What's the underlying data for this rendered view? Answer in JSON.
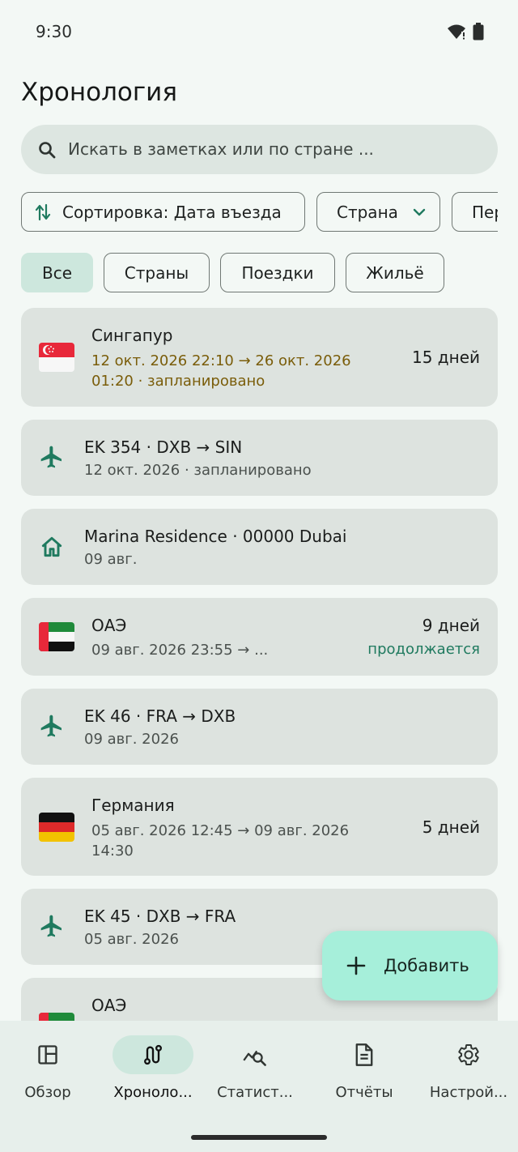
{
  "status_bar": {
    "time": "9:30"
  },
  "page_title": "Хронология",
  "search": {
    "placeholder": "Искать в заметках или по стране ..."
  },
  "chips": {
    "sort_label": "Сортировка: Дата въезда",
    "country_label": "Страна",
    "period_label": "Пер"
  },
  "filters": [
    {
      "label": "Все",
      "active": true
    },
    {
      "label": "Страны",
      "active": false
    },
    {
      "label": "Поездки",
      "active": false
    },
    {
      "label": "Жильё",
      "active": false
    }
  ],
  "timeline": [
    {
      "type": "country",
      "flag": "singapore-flag",
      "title": "Сингапур",
      "line1": "12 окт. 2026 22:10 → 26 окт. 2026",
      "line2": "01:20 · запланировано",
      "days": "15 дней",
      "planned": true
    },
    {
      "type": "flight",
      "icon": "airplane-icon",
      "title": "EK 354 · DXB → SIN",
      "sub": "12 окт. 2026 · запланировано"
    },
    {
      "type": "stay",
      "icon": "home-icon",
      "title": "Marina Residence · 00000 Dubai",
      "sub": "09 авг."
    },
    {
      "type": "country",
      "flag": "uae-flag",
      "title": "ОАЭ",
      "line1": "09 авг. 2026 23:55 → ...",
      "days": "9 дней",
      "status": "продолжается"
    },
    {
      "type": "flight",
      "icon": "airplane-icon",
      "title": "EK 46 · FRA → DXB",
      "sub": "09 авг. 2026"
    },
    {
      "type": "country",
      "flag": "germany-flag",
      "title": "Германия",
      "line1": "05 авг. 2026 12:45 → 09 авг. 2026",
      "line2": "14:30",
      "days": "5 дней"
    },
    {
      "type": "flight",
      "icon": "airplane-icon",
      "title": "EK 45 · DXB → FRA",
      "sub": "05 авг. 2026"
    },
    {
      "type": "country",
      "flag": "uae-flag",
      "title": "ОАЭ"
    }
  ],
  "fab": {
    "label": "Добавить"
  },
  "nav": [
    {
      "label": "Обзор",
      "icon": "dashboard-icon"
    },
    {
      "label": "Хроноло...",
      "icon": "route-icon",
      "active": true
    },
    {
      "label": "Статист...",
      "icon": "analytics-icon"
    },
    {
      "label": "Отчёты",
      "icon": "document-icon"
    },
    {
      "label": "Настрой...",
      "icon": "gear-icon"
    }
  ],
  "colors": {
    "background": "#f3f8f5",
    "card": "#dde3df",
    "accent": "#1f7a5f",
    "planned": "#7a5d0a",
    "fab": "#a6efda",
    "active_chip": "#cde7dd"
  }
}
